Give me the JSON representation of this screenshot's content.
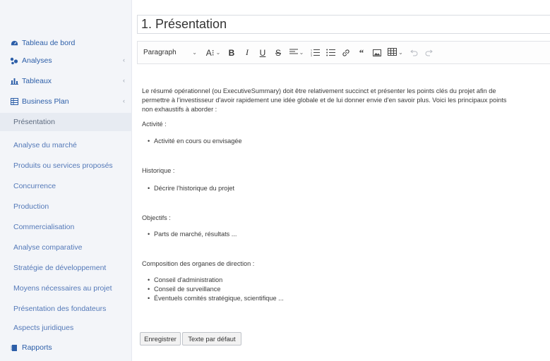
{
  "sidebar": {
    "items": [
      {
        "label": "Tableau de bord",
        "icon": "dashboard-icon"
      },
      {
        "label": "Analyses",
        "icon": "analyses-icon",
        "has_chevron": true
      },
      {
        "label": "Tableaux",
        "icon": "bar-chart-icon",
        "has_chevron": true
      },
      {
        "label": "Business Plan",
        "icon": "table-icon",
        "has_chevron": true
      }
    ],
    "sub_items": [
      {
        "label": "Présentation",
        "active": true
      },
      {
        "label": "Analyse du marché"
      },
      {
        "label": "Produits ou services proposés"
      },
      {
        "label": "Concurrence"
      },
      {
        "label": "Production"
      },
      {
        "label": "Commercialisation"
      },
      {
        "label": "Analyse comparative"
      },
      {
        "label": "Stratégie de développement"
      },
      {
        "label": "Moyens nécessaires au projet"
      },
      {
        "label": "Présentation des fondateurs"
      },
      {
        "label": "Aspects juridiques"
      }
    ],
    "reports": {
      "label": "Rapports",
      "icon": "reports-icon"
    }
  },
  "editor": {
    "title": "1. Présentation",
    "toolbar": {
      "paragraph_label": "Paragraph",
      "font_size_label": "A⁝",
      "bold_label": "B",
      "italic_label": "I",
      "underline_label": "U",
      "strike_label": "S"
    },
    "content": {
      "intro_line1": "Le résumé opérationnel (ou ExecutiveSummary) doit être relativement succinct et présenter les points clés du projet afin de",
      "intro_line2": "permettre à l'investisseur d'avoir rapidement une idée globale et de lui donner envie d'en savoir plus. Voici les principaux points",
      "intro_line3": "non exhaustifs à aborder :",
      "activite_heading": "Activité :",
      "activite_item": "Activité en cours ou envisagée",
      "historique_heading": "Historique :",
      "historique_item": "Décrire l'historique du projet",
      "objectifs_heading": "Objectifs :",
      "objectifs_item": "Parts de marché, résultats ...",
      "composition_heading": "Composition des organes de direction :",
      "composition_items": [
        "Conseil d'administration",
        "Conseil de surveillance",
        "Éventuels comités stratégique, scientifique ..."
      ]
    }
  },
  "buttons": {
    "save_label": "Enregistrer",
    "default_text_label": "Texte par défaut"
  },
  "colors": {
    "link": "#2c5ea8",
    "sidebar_bg": "#f3f5f9",
    "active_bg": "#e7ebf2"
  }
}
